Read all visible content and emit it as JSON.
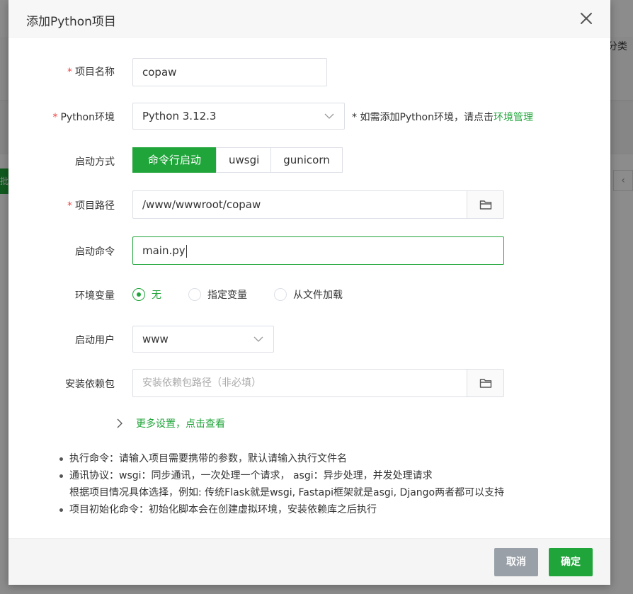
{
  "background": {
    "right_text": "分类",
    "left_text": "批"
  },
  "dialog": {
    "title": "添加Python项目",
    "form": {
      "name": {
        "label": "项目名称",
        "value": "copaw",
        "required": true
      },
      "python_env": {
        "label": "Python环境",
        "value": "Python 3.12.3",
        "required": true,
        "hint_prefix": "* 如需添加Python环境，请点击",
        "hint_link": "环境管理"
      },
      "start_mode": {
        "label": "启动方式",
        "options": [
          "命令行启动",
          "uwsgi",
          "gunicorn"
        ],
        "selected": "命令行启动"
      },
      "path": {
        "label": "项目路径",
        "value": "/www/wwwroot/copaw",
        "required": true
      },
      "start_cmd": {
        "label": "启动命令",
        "value": "main.py"
      },
      "env_vars": {
        "label": "环境变量",
        "options": [
          "无",
          "指定变量",
          "从文件加载"
        ],
        "selected": "无"
      },
      "user": {
        "label": "启动用户",
        "value": "www"
      },
      "deps": {
        "label": "安装依赖包",
        "placeholder": "安装依赖包路径（非必填）"
      }
    },
    "more_settings": "更多设置，点击查看",
    "notes": [
      "执行命令：请输入项目需要携带的参数，默认请输入执行文件名",
      "通讯协议：wsgi：同步通讯，一次处理一个请求， asgi：异步处理，并发处理请求",
      "根据项目情况具体选择，例如: 传统Flask就是wsgi, Fastapi框架就是asgi, Django两者都可以支持",
      "项目初始化命令：初始化脚本会在创建虚拟环境，安装依赖库之后执行"
    ],
    "footer": {
      "cancel": "取消",
      "confirm": "确定"
    }
  },
  "colors": {
    "accent": "#20a53a",
    "required": "#f04545",
    "cancel_btn": "#99a0a8"
  }
}
